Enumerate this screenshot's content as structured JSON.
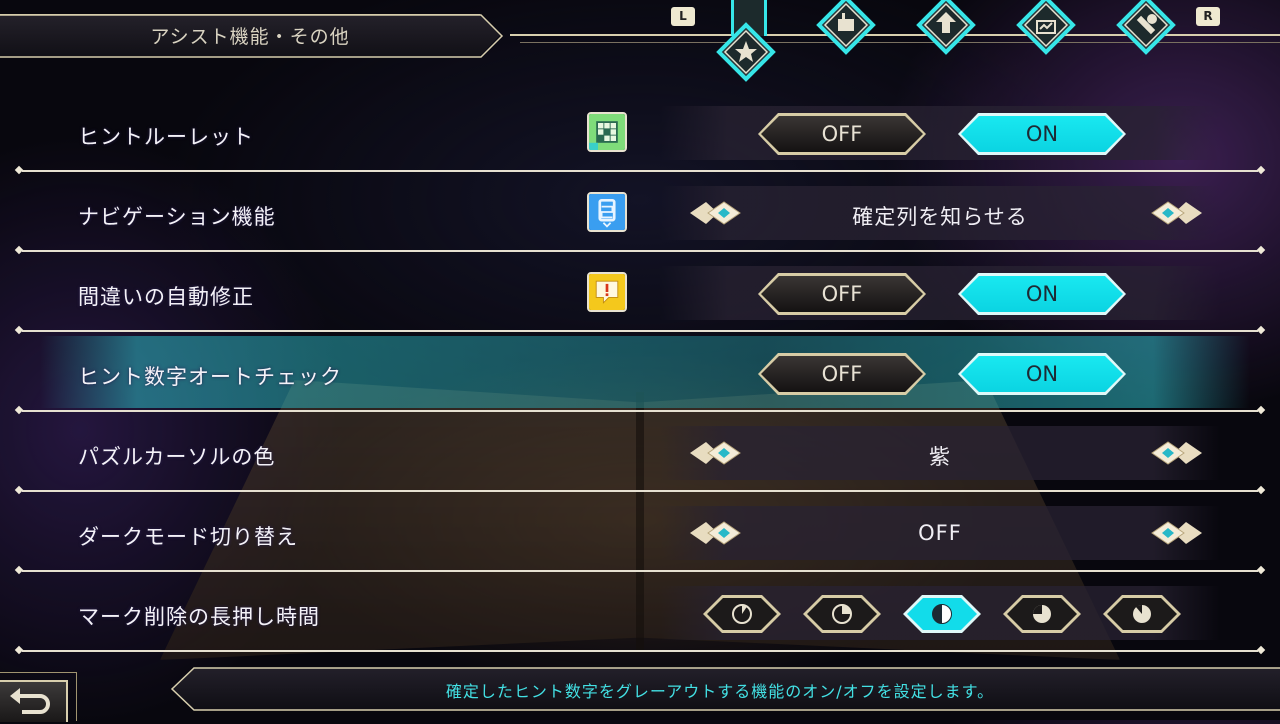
{
  "header": {
    "title": "アシスト機能・その他",
    "shoulder_left": "L",
    "shoulder_right": "R",
    "tabs": [
      {
        "icon": "star-icon",
        "active": true
      },
      {
        "icon": "puzzle-grid-icon",
        "active": false
      },
      {
        "icon": "crest-icon",
        "active": false
      },
      {
        "icon": "screen-chart-icon",
        "active": false
      },
      {
        "icon": "wrench-icon",
        "active": false
      }
    ]
  },
  "settings": [
    {
      "label": "ヒントルーレット",
      "type": "toggle",
      "off": "OFF",
      "on": "ON",
      "value": "ON",
      "icon": "roulette-grid-icon"
    },
    {
      "label": "ナビゲーション機能",
      "type": "select",
      "value": "確定列を知らせる",
      "icon": "navigation-icon"
    },
    {
      "label": "間違いの自動修正",
      "type": "toggle",
      "off": "OFF",
      "on": "ON",
      "value": "ON",
      "icon": "alert-icon"
    },
    {
      "label": "ヒント数字オートチェック",
      "type": "toggle",
      "off": "OFF",
      "on": "ON",
      "value": "ON",
      "selected_row": true
    },
    {
      "label": "パズルカーソルの色",
      "type": "select",
      "value": "紫"
    },
    {
      "label": "ダークモード切り替え",
      "type": "select",
      "value": "OFF"
    },
    {
      "label": "マーク削除の長押し時間",
      "type": "segments",
      "options": 5,
      "selected_index": 2
    }
  ],
  "help": {
    "text": "確定したヒント数字をグレーアウトする機能のオン/オフを設定します。"
  },
  "colors": {
    "accent_cyan": "#19e8f0",
    "help_text": "#43e0e4",
    "frame_gold": "#d7cca6"
  }
}
